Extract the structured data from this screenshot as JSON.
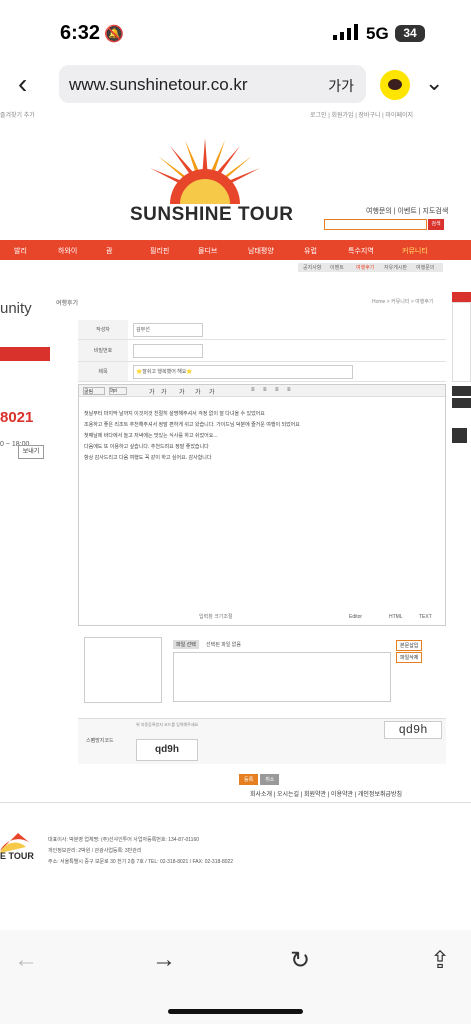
{
  "status": {
    "time": "6:32",
    "network": "5G",
    "battery": "34"
  },
  "browser": {
    "url": "www.sunshinetour.co.kr",
    "text_size": "가가"
  },
  "site": {
    "logo_text": "SUNSHINE TOUR",
    "top_links": "여행문의 | 이벤트 | 지도검색",
    "search_button": "검색",
    "nav": [
      "발리",
      "하와이",
      "괌",
      "필리핀",
      "몰디브",
      "남태평양",
      "유럽",
      "특수지역",
      "커뮤니티"
    ],
    "subnav": [
      "공지사항",
      "이벤트",
      "여행후기",
      "자유게시판",
      "여행문의"
    ],
    "board_title": "여행후기",
    "breadcrumb": "Home > 커뮤니티 > 여행후기",
    "left_title": "unity",
    "left_phone": "8021",
    "left_hours": "0 ~ 18:00",
    "left_btn": "보내기"
  },
  "form": {
    "author_label": "작성자",
    "author_value": "김부선",
    "password_label": "비밀번호",
    "subject_label": "제목",
    "subject_value": "⭐잘쉬고 행복했어 해요⭐",
    "toolbar": [
      "굴림",
      "9pt",
      "가",
      "가",
      "가",
      "가",
      "가",
      "≡",
      "≡",
      "≡",
      "≡"
    ],
    "content": [
      "첫날부터 마지막 날까지 이것저것 친절히 설명해주셔서 걱정 없이 잘 다녀올 수 있었어요",
      "조용하고 좋은 리조트 추천해주셔서 정말 편하게 쉬고 왔습니다. 가이드님 덕분에 즐거운 여행이 되었어요",
      "첫째날에 바다에서 놀고 저녁에는 맛있는 식사를 하고 쉬었어요...",
      "다음에도 또 이용하고 싶습니다. 추천드려요 정말 좋았습니다",
      "항상 감사드리고 다음 여행도 꼭 같이 하고 싶어요. 감사합니다"
    ],
    "editor_tabs": [
      "Editor",
      "HTML",
      "TEXT"
    ],
    "editor_resize": "입력창 크기조절",
    "attach_label": "파일 선택",
    "attach_text": "선택된 파일 없음",
    "attach_btn1": "본문삽입",
    "attach_btn2": "파일삭제",
    "captcha_label": "스팸방지코드",
    "captcha_hint": "위 자동등록방지 코드를 입력해주세요",
    "captcha_code": "qd9h",
    "btn_submit": "등록",
    "btn_cancel": "취소"
  },
  "footer": {
    "links": "회사소개 | 오시는길 | 회원약관 | 이용약관 | 개인정보취급방침",
    "logo_text": "E TOUR",
    "lines": [
      "대표이사: 박분영   업체명: (주)선샤인투어   사업자등록번호: 134-87-01160",
      "개인정보관리: 2박원 / 관광사업등록: 3반관리",
      "주소: 서울특별시 중구 보문로 30 전기 2층 7호 / TEL: 02-318-8021 / FAX: 02-318-8022"
    ]
  },
  "colors": {
    "brand": "#e8462b",
    "accent": "#e67e22"
  }
}
